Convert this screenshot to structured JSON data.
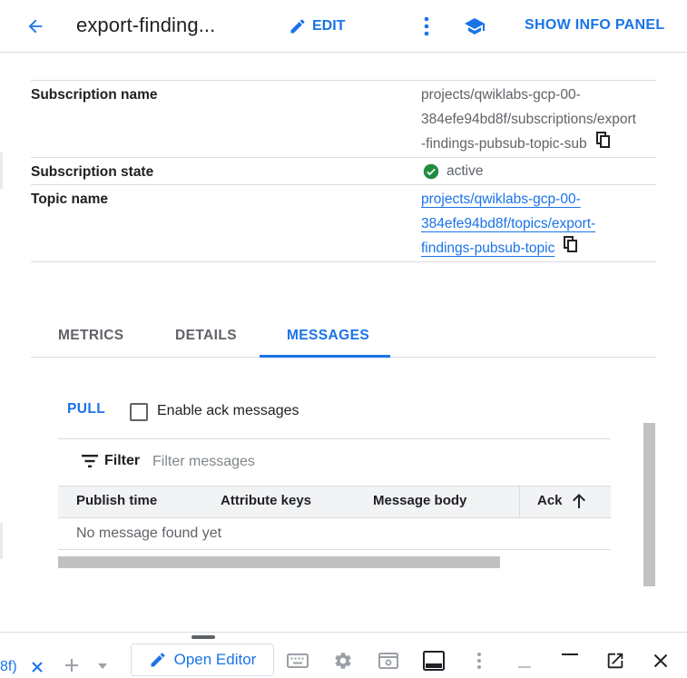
{
  "header": {
    "title": "export-finding...",
    "edit_label": "EDIT",
    "info_panel_label": "SHOW INFO PANEL"
  },
  "properties": {
    "subscription_name_label": "Subscription name",
    "subscription_name_lines": [
      "projects/qwiklabs-gcp-00-",
      "384efe94bd8f/subscriptions/export",
      "-findings-pubsub-topic-sub"
    ],
    "subscription_state_label": "Subscription state",
    "subscription_state_value": "active",
    "topic_name_label": "Topic name",
    "topic_name_lines": [
      "projects/qwiklabs-gcp-00-",
      "384efe94bd8f/topics/export-",
      "findings-pubsub-topic"
    ]
  },
  "tabs": [
    {
      "label": "METRICS"
    },
    {
      "label": "DETAILS"
    },
    {
      "label": "MESSAGES"
    }
  ],
  "messages": {
    "pull_label": "PULL",
    "enable_ack_label": "Enable ack messages",
    "filter_label": "Filter",
    "filter_placeholder": "Filter messages",
    "columns": [
      "Publish time",
      "Attribute keys",
      "Message body",
      "Ack"
    ],
    "empty_text": "No message found yet"
  },
  "bottom_bar": {
    "tab_text": "8f)",
    "open_editor_label": "Open Editor"
  },
  "colors": {
    "accent": "#1a73e8",
    "success": "#1e8e3e"
  }
}
